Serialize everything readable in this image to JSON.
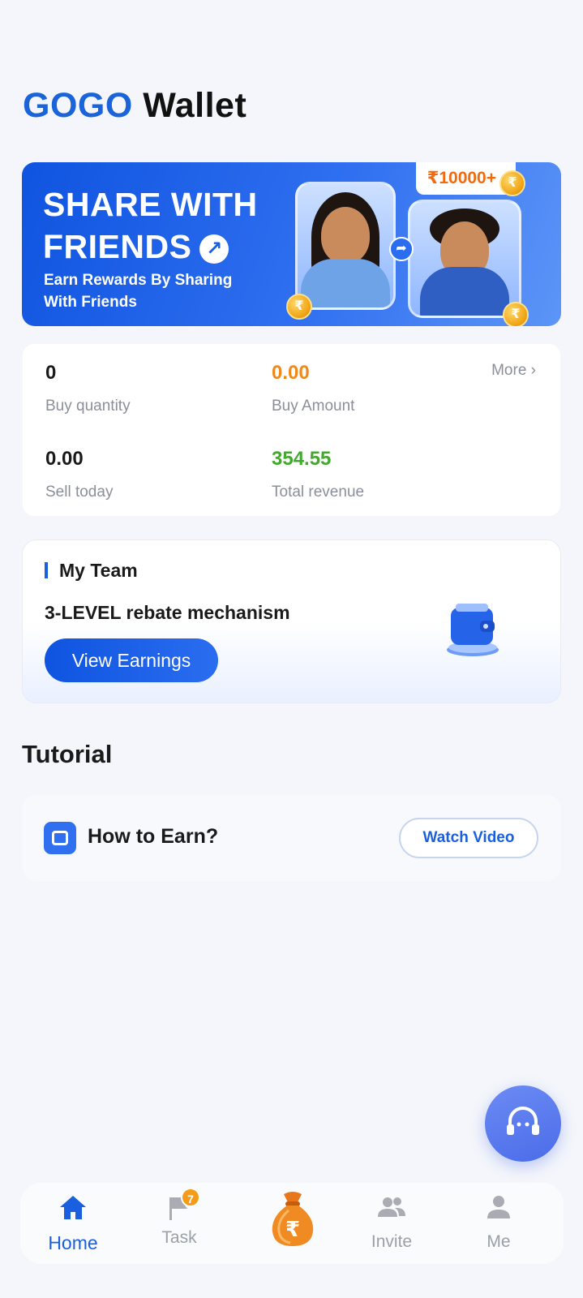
{
  "header": {
    "brand": "GOGO",
    "title": "Wallet"
  },
  "banner": {
    "title": "SHARE WITH\nFRIENDS",
    "subtitle": "Earn Rewards By Sharing With Friends",
    "reward": "₹10000+",
    "coin_symbol": "₹"
  },
  "stats": {
    "more_label": "More",
    "items": [
      {
        "value": "0",
        "label": "Buy quantity",
        "color": "#1a1a1a"
      },
      {
        "value": "0.00",
        "label": "Buy Amount",
        "color": "#f0891a"
      },
      {
        "value": "0.00",
        "label": "Sell today",
        "color": "#1a1a1a"
      },
      {
        "value": "354.55",
        "label": "Total revenue",
        "color": "#43a82e"
      }
    ]
  },
  "team": {
    "label": "My Team",
    "description": "3-LEVEL rebate mechanism",
    "button": "View Earnings"
  },
  "tutorial": {
    "title": "Tutorial",
    "item_text": "How to Earn?",
    "button": "Watch Video"
  },
  "nav": {
    "items": [
      {
        "label": "Home",
        "icon": "home-icon",
        "active": true
      },
      {
        "label": "Task",
        "icon": "flag-icon",
        "badge": "7"
      },
      {
        "label": "",
        "icon": "money-bag-icon",
        "symbol": "₹"
      },
      {
        "label": "Invite",
        "icon": "people-icon"
      },
      {
        "label": "Me",
        "icon": "person-icon"
      }
    ]
  },
  "colors": {
    "accent": "#1a5fe0",
    "orange": "#f0891a",
    "green": "#43a82e"
  }
}
